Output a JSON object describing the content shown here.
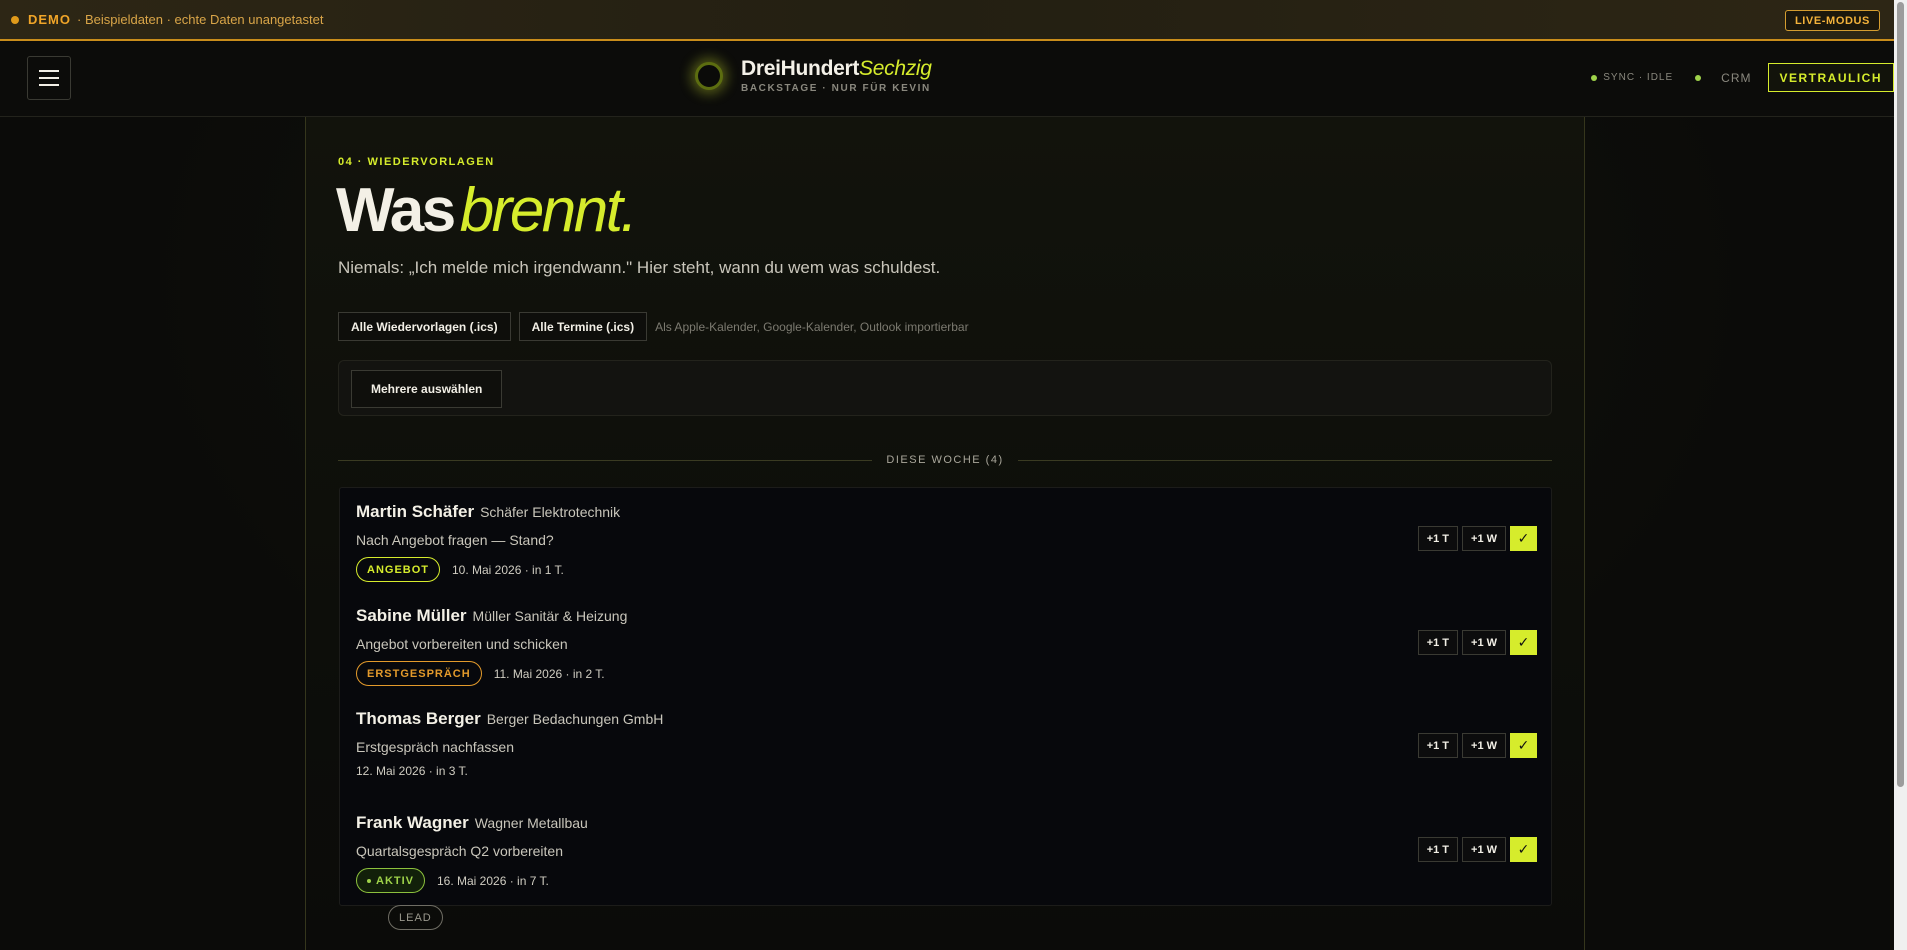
{
  "demo_bar": {
    "label": "DEMO",
    "text": "· Beispieldaten · echte Daten unangetastet",
    "live_mode": "LIVE-MODUS"
  },
  "header": {
    "brand_main": "DreiHundert",
    "brand_accent": "Sechzig",
    "brand_sub": "BACKSTAGE · NUR FÜR KEVIN",
    "sync": "SYNC · IDLE",
    "crm": "CRM",
    "confidential": "VERTRAULICH"
  },
  "page": {
    "kicker": "04 · WIEDERVORLAGEN",
    "title_main": "Was",
    "title_accent": "brennt.",
    "lead": "Niemals: „Ich melde mich irgendwann.\" Hier steht, wann du wem was schuldest.",
    "export_followups": "Alle Wiedervorlagen (.ics)",
    "export_appointments": "Alle Termine (.ics)",
    "export_hint": "Als Apple-Kalender, Google-Kalender, Outlook importierbar",
    "select_multiple": "Mehrere auswählen",
    "week_label": "DIESE WOCHE (4)"
  },
  "items": [
    {
      "person": "Martin Schäfer",
      "company": "Schäfer Elektrotechnik",
      "task": "Nach Angebot fragen — Stand?",
      "badge": "ANGEBOT",
      "date": "10. Mai 2026 · in 1 T.",
      "plus_day": "+1 T",
      "plus_week": "+1 W",
      "done": "✓"
    },
    {
      "person": "Sabine Müller",
      "company": "Müller Sanitär & Heizung",
      "task": "Angebot vorbereiten und schicken",
      "badge": "ERSTGESPRÄCH",
      "date": "11. Mai 2026 · in 2 T.",
      "plus_day": "+1 T",
      "plus_week": "+1 W",
      "done": "✓"
    },
    {
      "person": "Thomas Berger",
      "company": "Berger Bedachungen GmbH",
      "task": "Erstgespräch nachfassen",
      "badge": "LEAD",
      "date": "12. Mai 2026 · in 3 T.",
      "plus_day": "+1 T",
      "plus_week": "+1 W",
      "done": "✓"
    },
    {
      "person": "Frank Wagner",
      "company": "Wagner Metallbau",
      "task": "Quartalsgespräch Q2 vorbereiten",
      "badge": "AKTIV",
      "date": "16. Mai 2026 · in 7 T.",
      "plus_day": "+1 T",
      "plus_week": "+1 W",
      "done": "✓"
    }
  ],
  "colors": {
    "accent": "#d6ec2c",
    "demo_orange": "#e09a1b",
    "status_green": "#9fd34a",
    "background": "#0b0b09"
  },
  "icons": [
    "menu-icon",
    "brand-logo-icon",
    "status-dot-icon",
    "check-icon"
  ]
}
